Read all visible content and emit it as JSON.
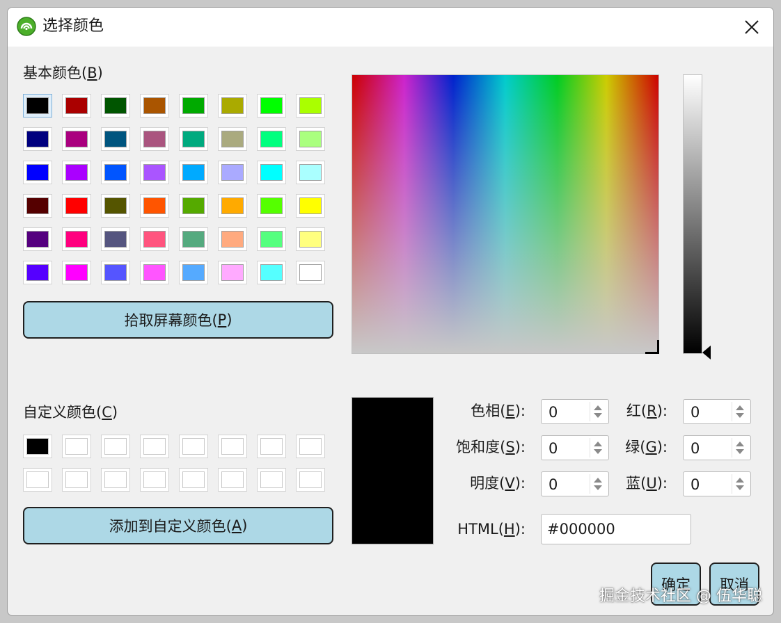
{
  "window": {
    "title": "选择颜色",
    "close_icon": "close-icon"
  },
  "basic": {
    "label_pre": "基本颜色(",
    "label_key": "B",
    "label_post": ")",
    "colors": [
      [
        "#000000",
        "#aa0000",
        "#005500",
        "#aa5500",
        "#00aa00",
        "#aaaa00",
        "#00ff00",
        "#aaff00"
      ],
      [
        "#00007f",
        "#aa007f",
        "#00557f",
        "#aa557f",
        "#00aa7f",
        "#aaaa7f",
        "#00ff7f",
        "#aaff7f"
      ],
      [
        "#0000ff",
        "#aa00ff",
        "#0055ff",
        "#aa55ff",
        "#00aaff",
        "#aaaaff",
        "#00ffff",
        "#aaffff"
      ],
      [
        "#550000",
        "#ff0000",
        "#555500",
        "#ff5500",
        "#55aa00",
        "#ffaa00",
        "#55ff00",
        "#ffff00"
      ],
      [
        "#55007f",
        "#ff007f",
        "#55557f",
        "#ff557f",
        "#55aa7f",
        "#ffaa7f",
        "#55ff7f",
        "#ffff7f"
      ],
      [
        "#5500ff",
        "#ff00ff",
        "#5555ff",
        "#ff55ff",
        "#55aaff",
        "#ffaaff",
        "#55ffff",
        "#ffffff"
      ]
    ],
    "selected": 0
  },
  "pick_screen": {
    "label_pre": "拾取屏幕颜色(",
    "label_key": "P",
    "label_post": ")"
  },
  "custom": {
    "label_pre": "自定义颜色(",
    "label_key": "C",
    "label_post": ")",
    "colors": [
      [
        "#000000",
        "#ffffff",
        "#ffffff",
        "#ffffff",
        "#ffffff",
        "#ffffff",
        "#ffffff",
        "#ffffff"
      ],
      [
        "#ffffff",
        "#ffffff",
        "#ffffff",
        "#ffffff",
        "#ffffff",
        "#ffffff",
        "#ffffff",
        "#ffffff"
      ]
    ]
  },
  "add_custom": {
    "label_pre": "添加到自定义颜色(",
    "label_key": "A",
    "label_post": ")"
  },
  "current_color": "#000000",
  "fields": {
    "hue": {
      "pre": "色相(",
      "key": "E",
      "post": "):",
      "value": "0"
    },
    "sat": {
      "pre": "饱和度(",
      "key": "S",
      "post": "):",
      "value": "0"
    },
    "val": {
      "pre": "明度(",
      "key": "V",
      "post": "):",
      "value": "0"
    },
    "red": {
      "pre": "红(",
      "key": "R",
      "post": "):",
      "value": "0"
    },
    "green": {
      "pre": "绿(",
      "key": "G",
      "post": "):",
      "value": "0"
    },
    "blue": {
      "pre": "蓝(",
      "key": "U",
      "post": "):",
      "value": "0"
    },
    "html": {
      "pre": "HTML(",
      "key": "H",
      "post": "):",
      "value": "#000000"
    }
  },
  "buttons": {
    "ok": "确定",
    "cancel": "取消"
  },
  "watermark": "掘金技术社区 @ 伍华聪"
}
